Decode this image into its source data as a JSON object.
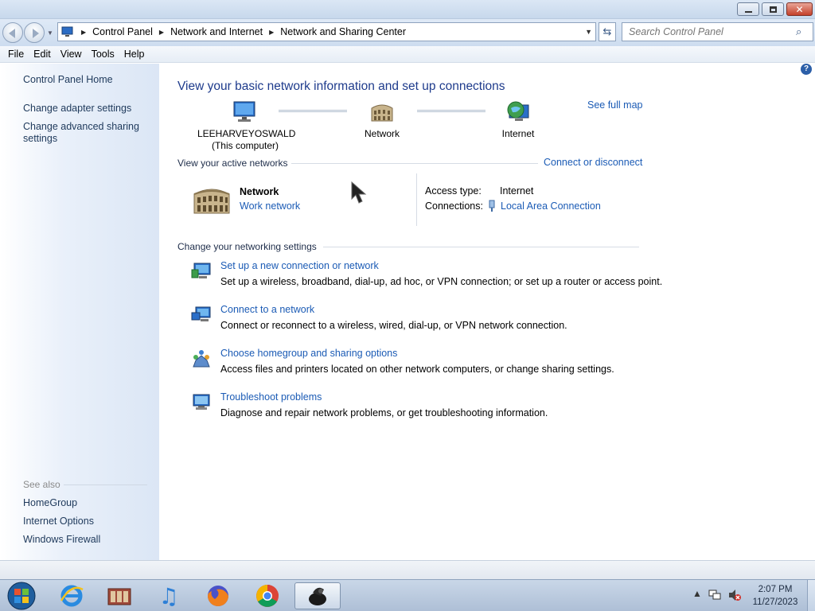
{
  "window": {
    "controls": [
      "minimize",
      "maximize",
      "close"
    ]
  },
  "address": {
    "breadcrumbs": [
      "Control Panel",
      "Network and Internet",
      "Network and Sharing Center"
    ],
    "search_placeholder": "Search Control Panel"
  },
  "menu": [
    "File",
    "Edit",
    "View",
    "Tools",
    "Help"
  ],
  "sidebar": {
    "items": [
      "Control Panel Home",
      "Change adapter settings",
      "Change advanced sharing settings"
    ],
    "see_also_label": "See also",
    "see_also": [
      "HomeGroup",
      "Internet Options",
      "Windows Firewall"
    ]
  },
  "main": {
    "heading": "View your basic network information and set up connections",
    "see_full_map": "See full map",
    "map": {
      "computer_name": "LEEHARVEYOSWALD",
      "computer_sub": "(This computer)",
      "network": "Network",
      "internet": "Internet"
    },
    "active_networks": {
      "title": "View your active networks",
      "connect_link": "Connect or disconnect",
      "network_name": "Network",
      "network_type": "Work network",
      "access_type_label": "Access type:",
      "access_type_value": "Internet",
      "connections_label": "Connections:",
      "connections_value": "Local Area Connection"
    },
    "settings": {
      "title": "Change your networking settings",
      "tasks": [
        {
          "title": "Set up a new connection or network",
          "desc": "Set up a wireless, broadband, dial-up, ad hoc, or VPN connection; or set up a router or access point."
        },
        {
          "title": "Connect to a network",
          "desc": "Connect or reconnect to a wireless, wired, dial-up, or VPN network connection."
        },
        {
          "title": "Choose homegroup and sharing options",
          "desc": "Access files and printers located on other network computers, or change sharing settings."
        },
        {
          "title": "Troubleshoot problems",
          "desc": "Diagnose and repair network problems, or get troubleshooting information."
        }
      ]
    }
  },
  "taskbar": {
    "apps": [
      "start-orb",
      "internet-explorer",
      "media-center",
      "itunes",
      "firefox",
      "chrome",
      "active-app"
    ],
    "time": "2:07 PM",
    "date": "11/27/2023"
  }
}
